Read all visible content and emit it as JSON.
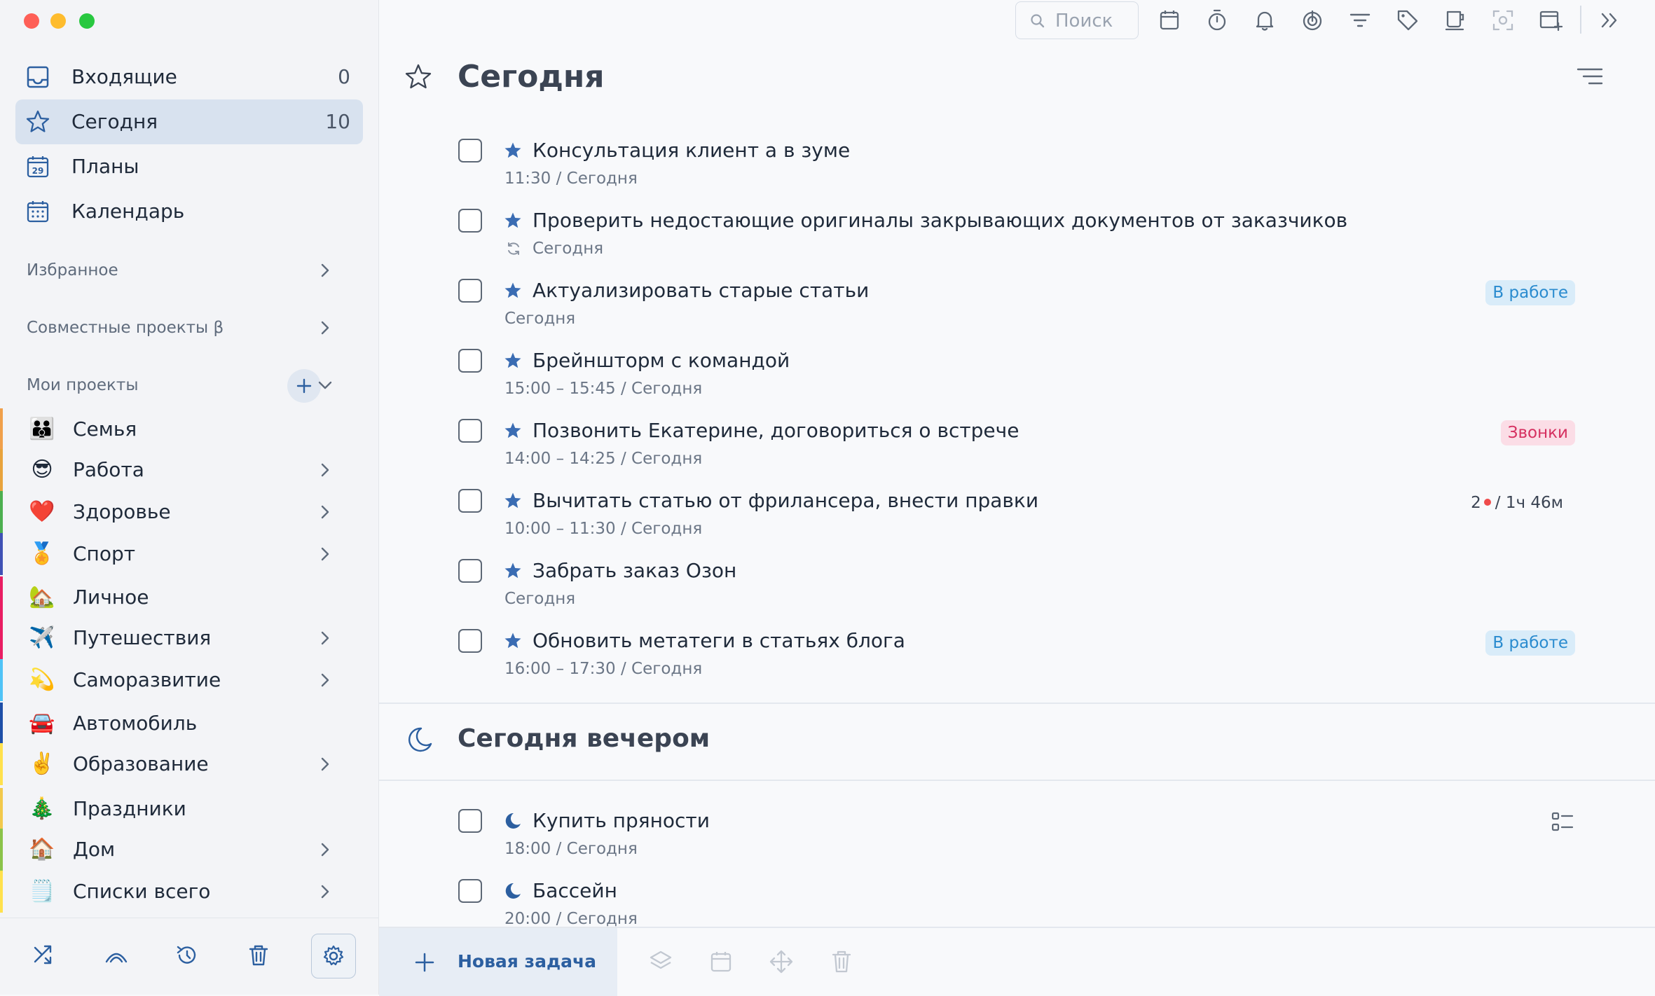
{
  "sidebar": {
    "nav": [
      {
        "label": "Входящие",
        "count": "0"
      },
      {
        "label": "Сегодня",
        "count": "10"
      },
      {
        "label": "Планы",
        "count": ""
      },
      {
        "label": "Календарь",
        "count": ""
      }
    ],
    "plans_icon_day": "29",
    "sections": {
      "favorites": "Избранное",
      "shared": "Совместные проекты β",
      "my_projects": "Мои проекты"
    },
    "projects": [
      {
        "label": "Семья",
        "emoji": "👪",
        "color": "#f0a04b",
        "has_children": false
      },
      {
        "label": "Работа",
        "emoji": "😎",
        "color": "#e8a33d",
        "has_children": true
      },
      {
        "label": "Здоровье",
        "emoji": "❤️",
        "color": "#4caf50",
        "has_children": true
      },
      {
        "label": "Спорт",
        "emoji": "🏅",
        "color": "#3f51b5",
        "has_children": true
      },
      {
        "label": "Личное",
        "emoji": "🏡",
        "color": "#e91e63",
        "has_children": false
      },
      {
        "label": "Путешествия",
        "emoji": "✈️",
        "color": "#e91e63",
        "has_children": true
      },
      {
        "label": "Саморазвитие",
        "emoji": "💫",
        "color": "#4fc3f7",
        "has_children": true
      },
      {
        "label": "Автомобиль",
        "emoji": "🚘",
        "color": "#1e4fa8",
        "has_children": false
      },
      {
        "label": "Образование",
        "emoji": "✌️",
        "color": "#ffe14d",
        "has_children": true
      },
      {
        "label": "Праздники",
        "emoji": "🎄",
        "color": "#f2c94c",
        "has_children": false
      },
      {
        "label": "Дом",
        "emoji": "🏠",
        "color": "#8bc34a",
        "has_children": true
      },
      {
        "label": "Списки всего",
        "emoji": "🗒️",
        "color": "#ffe14d",
        "has_children": true
      }
    ]
  },
  "header": {
    "search_placeholder": "Поиск"
  },
  "main": {
    "title": "Сегодня",
    "tasks": [
      {
        "title": "Консультация клиент а в зуме",
        "sub": "11:30 / Сегодня",
        "repeat": false,
        "tag": "",
        "tag_style": ""
      },
      {
        "title": "Проверить недостающие оригиналы закрывающих документов от заказчиков",
        "sub": "Сегодня",
        "repeat": true,
        "tag": "",
        "tag_style": ""
      },
      {
        "title": "Актуализировать старые статьи",
        "sub": "Сегодня",
        "repeat": false,
        "tag": "В работе",
        "tag_style": "blue"
      },
      {
        "title": "Брейншторм с командой",
        "sub": "15:00 – 15:45 / Сегодня",
        "repeat": false,
        "tag": "",
        "tag_style": ""
      },
      {
        "title": "Позвонить Екатерине, договориться о встрече",
        "sub": "14:00 – 14:25 / Сегодня",
        "repeat": false,
        "tag": "Звонки",
        "tag_style": "pink"
      },
      {
        "title": "Вычитать статью от фрилансера, внести правки",
        "sub": "10:00 – 11:30 / Сегодня",
        "repeat": false,
        "tag": "",
        "tag_style": "",
        "timer_count": "2",
        "timer_time": "/ 1ч 46м"
      },
      {
        "title": "Забрать заказ Озон",
        "sub": "Сегодня",
        "repeat": false,
        "tag": "",
        "tag_style": ""
      },
      {
        "title": "Обновить метатеги в статьях блога",
        "sub": "16:00 – 17:30 / Сегодня",
        "repeat": false,
        "tag": "В работе",
        "tag_style": "blue"
      }
    ],
    "evening": {
      "title": "Сегодня вечером",
      "tasks": [
        {
          "title": "Купить пряности",
          "sub": "18:00 / Сегодня"
        },
        {
          "title": "Бассейн",
          "sub": "20:00 / Сегодня"
        }
      ]
    }
  },
  "bottom": {
    "new_task": "Новая задача"
  },
  "colors": {
    "accent": "#2c5fa0",
    "star": "#3a6cb3",
    "tag_blue": "#2a8bcf",
    "tag_pink": "#d63060"
  }
}
